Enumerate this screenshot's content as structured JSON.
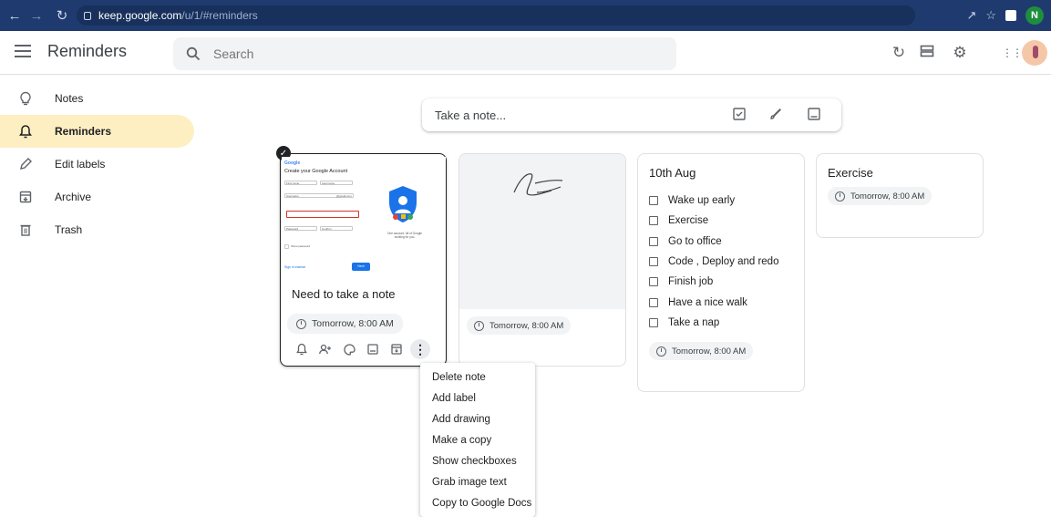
{
  "browser": {
    "url_domain": "keep.google.com",
    "url_path": "/u/1/#reminders",
    "profile_initial": "N"
  },
  "app": {
    "title": "Reminders",
    "search_placeholder": "Search"
  },
  "sidebar": {
    "items": [
      {
        "label": "Notes",
        "icon": "lightbulb-icon"
      },
      {
        "label": "Reminders",
        "icon": "bell-icon",
        "active": true
      },
      {
        "label": "Edit labels",
        "icon": "pencil-icon"
      },
      {
        "label": "Archive",
        "icon": "archive-icon"
      },
      {
        "label": "Trash",
        "icon": "trash-icon"
      }
    ]
  },
  "take_note": {
    "placeholder": "Take a note..."
  },
  "notes": [
    {
      "title": "Need to take a note",
      "reminder": "Tomorrow, 8:00 AM",
      "image": {
        "brand": "Google",
        "heading": "Create your Google Account",
        "fields": [
          "First name",
          "Last name",
          "Username",
          "@gmail.com",
          "Password",
          "Confirm"
        ],
        "show_password": "Show password",
        "sign_in": "Sign in instead",
        "next": "Next",
        "caption": "One account. All of Google working for you."
      }
    },
    {
      "title": "",
      "reminder": "Tomorrow, 8:00 AM"
    },
    {
      "title": "10th Aug",
      "items": [
        "Wake up early",
        "Exercise",
        "Go to office",
        "Code , Deploy and redo",
        "Finish job",
        "Have a nice walk",
        "Take a nap"
      ],
      "reminder": "Tomorrow, 8:00 AM"
    },
    {
      "title": "Exercise",
      "reminder": "Tomorrow, 8:00 AM"
    }
  ],
  "context_menu": {
    "items": [
      "Delete note",
      "Add label",
      "Add drawing",
      "Make a copy",
      "Show checkboxes",
      "Grab image text",
      "Copy to Google Docs"
    ]
  },
  "colors": {
    "accent_active": "#feefc3",
    "browser_frame": "#1f3a6e",
    "google_blue": "#1a73e8"
  }
}
